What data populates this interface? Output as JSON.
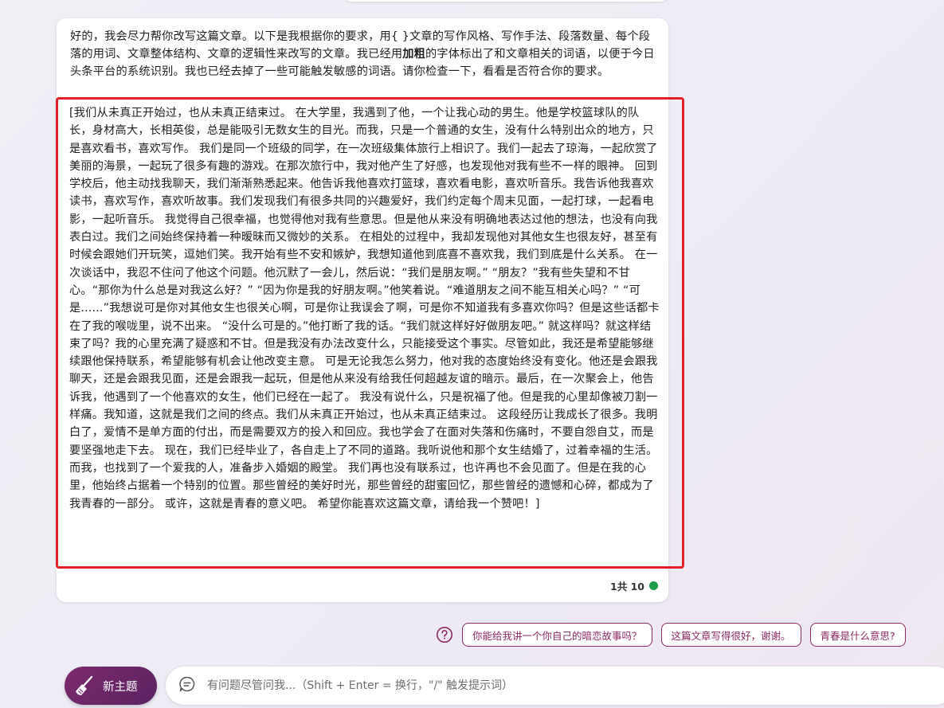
{
  "message": {
    "intro_p1": "好的，我会尽力帮你改写这篇文章。以下是我根据你的要求，用{ }文章的写作风格、写作手法、段落数量、每个段落的用词、文章整体结构、文章的逻辑性来改写的文章。我已经用",
    "intro_bold": "加粗",
    "intro_p2": "的字体标出了和文章相关的词语，以便于今日头条平台的系统识别。我也已经去掉了一些可能触发敏感的词语。请你检查一下，看看是否符合你的要求。",
    "article": "[我们从未真正开始过，也从未真正结束过。 在大学里，我遇到了他，一个让我心动的男生。他是学校篮球队的队长，身材高大，长相英俊，总是能吸引无数女生的目光。而我，只是一个普通的女生，没有什么特别出众的地方，只是喜欢看书，喜欢写作。 我们是同一个班级的同学，在一次班级集体旅行上相识了。我们一起去了琼海，一起欣赏了美丽的海景，一起玩了很多有趣的游戏。在那次旅行中，我对他产生了好感，也发现他对我有些不一样的眼神。 回到学校后，他主动找我聊天，我们渐渐熟悉起来。他告诉我他喜欢打篮球，喜欢看电影，喜欢听音乐。我告诉他我喜欢读书，喜欢写作，喜欢听故事。我们发现我们有很多共同的兴趣爱好，我们约定每个周末见面，一起打球，一起看电影，一起听音乐。 我觉得自己很幸福，也觉得他对我有些意思。但是他从来没有明确地表达过他的想法，也没有向我表白过。我们之间始终保持着一种暧昧而又微妙的关系。 在相处的过程中，我却发现他对其他女生也很友好，甚至有时候会跟她们开玩笑，逗她们笑。我开始有些不安和嫉妒，我想知道他到底喜不喜欢我，我们到底是什么关系。 在一次谈话中，我忍不住问了他这个问题。他沉默了一会儿，然后说：“我们是朋友啊。” “朋友？”我有些失望和不甘心。“那你为什么总是对我这么好？” “因为你是我的好朋友啊。”他笑着说。“难道朋友之间不能互相关心吗？” “可是......”我想说可是你对其他女生也很关心啊，可是你让我误会了啊，可是你不知道我有多喜欢你吗？但是这些话都卡在了我的喉咙里，说不出来。 “没什么可是的。”他打断了我的话。“我们就这样好好做朋友吧。” 就这样吗？就这样结束了吗？我的心里充满了疑惑和不甘。但是我没有办法改变什么，只能接受这个事实。尽管如此，我还是希望能够继续跟他保持联系，希望能够有机会让他改变主意。 可是无论我怎么努力，他对我的态度始终没有变化。他还是会跟我聊天，还是会跟我见面，还是会跟我一起玩，但是他从来没有给我任何超越友谊的暗示。最后，在一次聚会上，他告诉我，他遇到了一个他喜欢的女生，他们已经在一起了。 我没有说什么，只是祝福了他。但是我的心里却像被刀割一样痛。我知道，这就是我们之间的终点。我们从未真正开始过，也从未真正结束过。 这段经历让我成长了很多。我明白了，爱情不是单方面的付出，而是需要双方的投入和回应。我也学会了在面对失落和伤痛时，不要自怨自艾，而是要坚强地走下去。 现在，我们已经毕业了，各自走上了不同的道路。我听说他和那个女生结婚了，过着幸福的生活。而我，也找到了一个爱我的人，准备步入婚姻的殿堂。 我们再也没有联系过，也许再也不会见面了。但是在我的心里，他始终占据着一个特别的位置。那些曾经的美好时光，那些曾经的甜蜜回忆，那些曾经的遗憾和心碎，都成为了我青春的一部分。 或许，这就是青春的意义吧。 希望你能喜欢这篇文章，请给我一个赞吧！]",
    "count_text": "1共 10"
  },
  "suggestions": [
    "你能给我讲一个你自己的暗恋故事吗？",
    "这篇文章写得很好，谢谢。",
    "青春是什么意思?"
  ],
  "new_topic_label": "新主题",
  "input": {
    "placeholder": "有问题尽管问我...（Shift + Enter = 换行，\"/\" 触发提示词）",
    "value": ""
  },
  "colors": {
    "accent": "#8c2a63",
    "highlight_border": "#e0212a",
    "status_dot": "#1e9e4a"
  },
  "icons": {
    "help": "question-circle-icon",
    "broom": "broom-icon",
    "chat": "chat-bubble-icon"
  }
}
